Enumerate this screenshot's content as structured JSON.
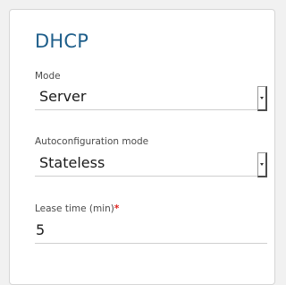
{
  "section": {
    "title": "DHCP"
  },
  "fields": {
    "mode": {
      "label": "Mode",
      "value": "Server"
    },
    "autoconfiguration_mode": {
      "label": "Autoconfiguration mode",
      "value": "Stateless"
    },
    "lease_time": {
      "label": "Lease time (min)",
      "required_marker": "*",
      "value": "5"
    }
  },
  "colors": {
    "title": "#1f5f8b",
    "required": "#e0201b"
  },
  "icons": {
    "dropdown": "chevron-down-icon"
  }
}
